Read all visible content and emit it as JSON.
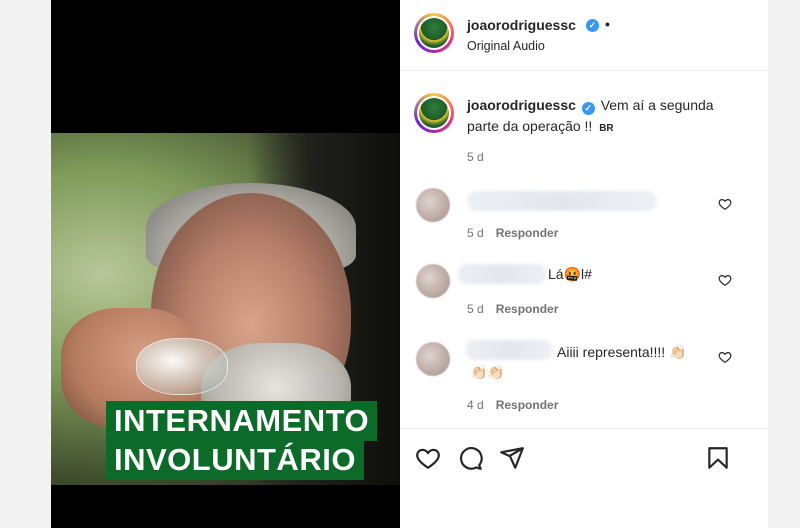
{
  "media": {
    "overlay_line1": "INTERNAMENTO",
    "overlay_line2": "INVOLUNTÁRIO"
  },
  "post": {
    "username": "joaorodriguessc",
    "audio": "Original Audio",
    "more_dot": "•",
    "caption": "Vem aí a segunda parte da operação !!",
    "caption_flag": "BR",
    "caption_age": "5 d"
  },
  "comments": [
    {
      "text": "",
      "age": "5 d",
      "reply_label": "Responder"
    },
    {
      "text": "Lá🤬l#",
      "age": "5 d",
      "reply_label": "Responder"
    },
    {
      "text": "Aiiii representa!!!! 👏🏻",
      "text2": "👏🏻👏🏻",
      "age": "4 d",
      "reply_label": "Responder"
    }
  ],
  "icons": {
    "like": "heart-icon",
    "comment": "comment-icon",
    "share": "send-icon",
    "save": "bookmark-icon",
    "verified": "verified-badge-icon"
  },
  "colors": {
    "overlay_green": "#0d6b2a",
    "verified_blue": "#3897f0",
    "text": "#262626",
    "muted": "#737373"
  }
}
